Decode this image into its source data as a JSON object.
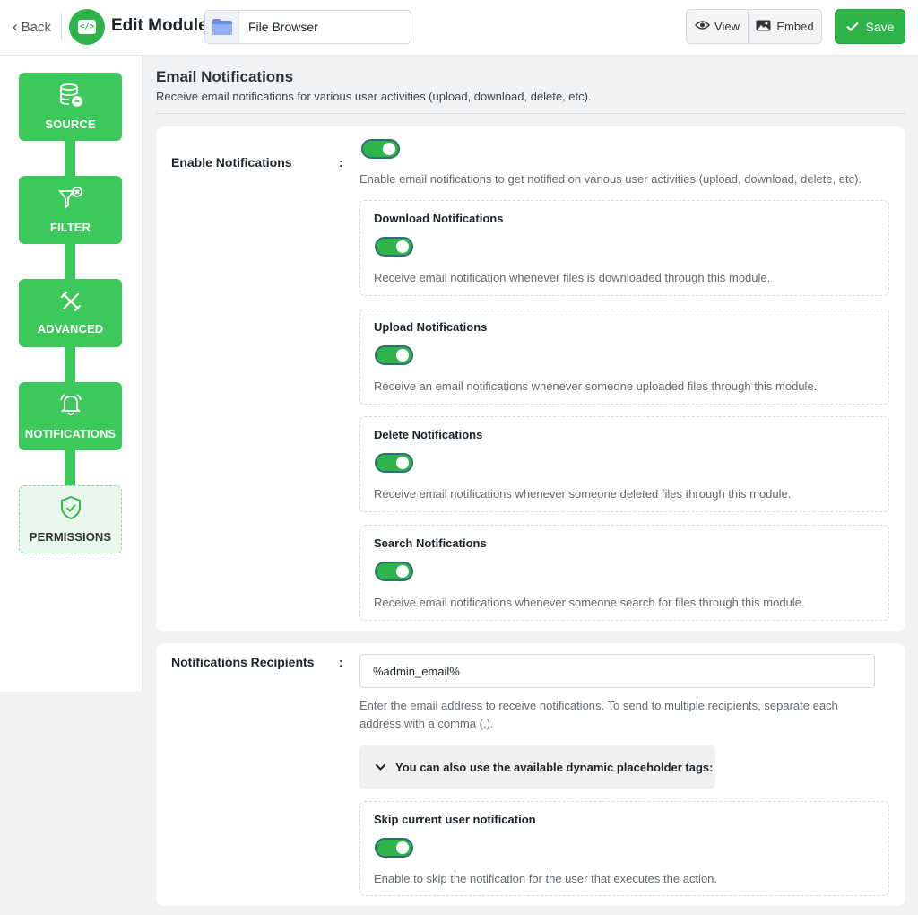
{
  "header": {
    "back_label": "Back",
    "title": "Edit Module",
    "module_name": "File Browser",
    "view_label": "View",
    "embed_label": "Embed",
    "save_label": "Save",
    "accent_color": "#2fb44a"
  },
  "sidebar": {
    "steps": [
      {
        "label": "SOURCE",
        "icon": "database-icon",
        "state": "done"
      },
      {
        "label": "FILTER",
        "icon": "filter-icon",
        "state": "done"
      },
      {
        "label": "ADVANCED",
        "icon": "tools-icon",
        "state": "done"
      },
      {
        "label": "NOTIFICATIONS",
        "icon": "bell-icon",
        "state": "active"
      },
      {
        "label": "PERMISSIONS",
        "icon": "shield-check-icon",
        "state": "pending"
      }
    ]
  },
  "section": {
    "title": "Email Notifications",
    "description": "Receive email notifications for various user activities (upload, download, delete, etc)."
  },
  "enable": {
    "label": "Enable Notifications",
    "colon": ":",
    "enabled": true,
    "hint": "Enable email notifications to get notified on various user activities (upload, download, delete, etc)."
  },
  "subs": [
    {
      "title": "Download Notifications",
      "enabled": true,
      "hint": "Receive email notification whenever files is downloaded through this module."
    },
    {
      "title": "Upload Notifications",
      "enabled": true,
      "hint": "Receive an email notifications whenever someone uploaded files through this module."
    },
    {
      "title": "Delete Notifications",
      "enabled": true,
      "hint": "Receive email notifications whenever someone deleted files through this module."
    },
    {
      "title": "Search Notifications",
      "enabled": true,
      "hint": "Receive email notifications whenever someone search for files through this module."
    }
  ],
  "recipients": {
    "label": "Notifications Recipients",
    "colon": ":",
    "value": "%admin_email%",
    "hint_line1": "Enter the email address to receive notifications. To send to multiple recipients, separate each",
    "hint_line2": "address with a comma (,).",
    "placeholder_toggle": "You can also use the available dynamic placeholder tags:"
  },
  "skip": {
    "title": "Skip current user notification",
    "enabled": true,
    "hint": "Enable to skip the notification for the user that executes the action."
  }
}
